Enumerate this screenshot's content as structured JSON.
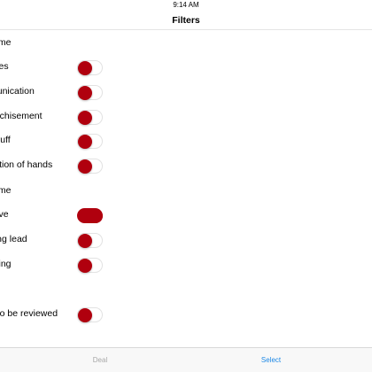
{
  "status_bar": {
    "time": "9:14 AM"
  },
  "nav": {
    "title": "Filters"
  },
  "sections": {
    "first": "ame",
    "second": "ame"
  },
  "rows": [
    {
      "label": "sses",
      "on": false
    },
    {
      "label": "munication",
      "on": false
    },
    {
      "label": "anchisement",
      "on": false
    },
    {
      "label": "s-ruff",
      "on": false
    },
    {
      "label": "uction of hands",
      "on": false
    },
    {
      "label": "ctive",
      "on": true
    },
    {
      "label": "ning lead",
      "on": false
    },
    {
      "label": "alling",
      "on": false
    },
    {
      "label": "d to be reviewed",
      "on": false
    }
  ],
  "tabs": {
    "deal": "Deal",
    "select": "Select"
  },
  "colors": {
    "accent": "#b0000e",
    "tab_active": "#1e88e5",
    "tab_inactive": "#a7a7a7"
  }
}
